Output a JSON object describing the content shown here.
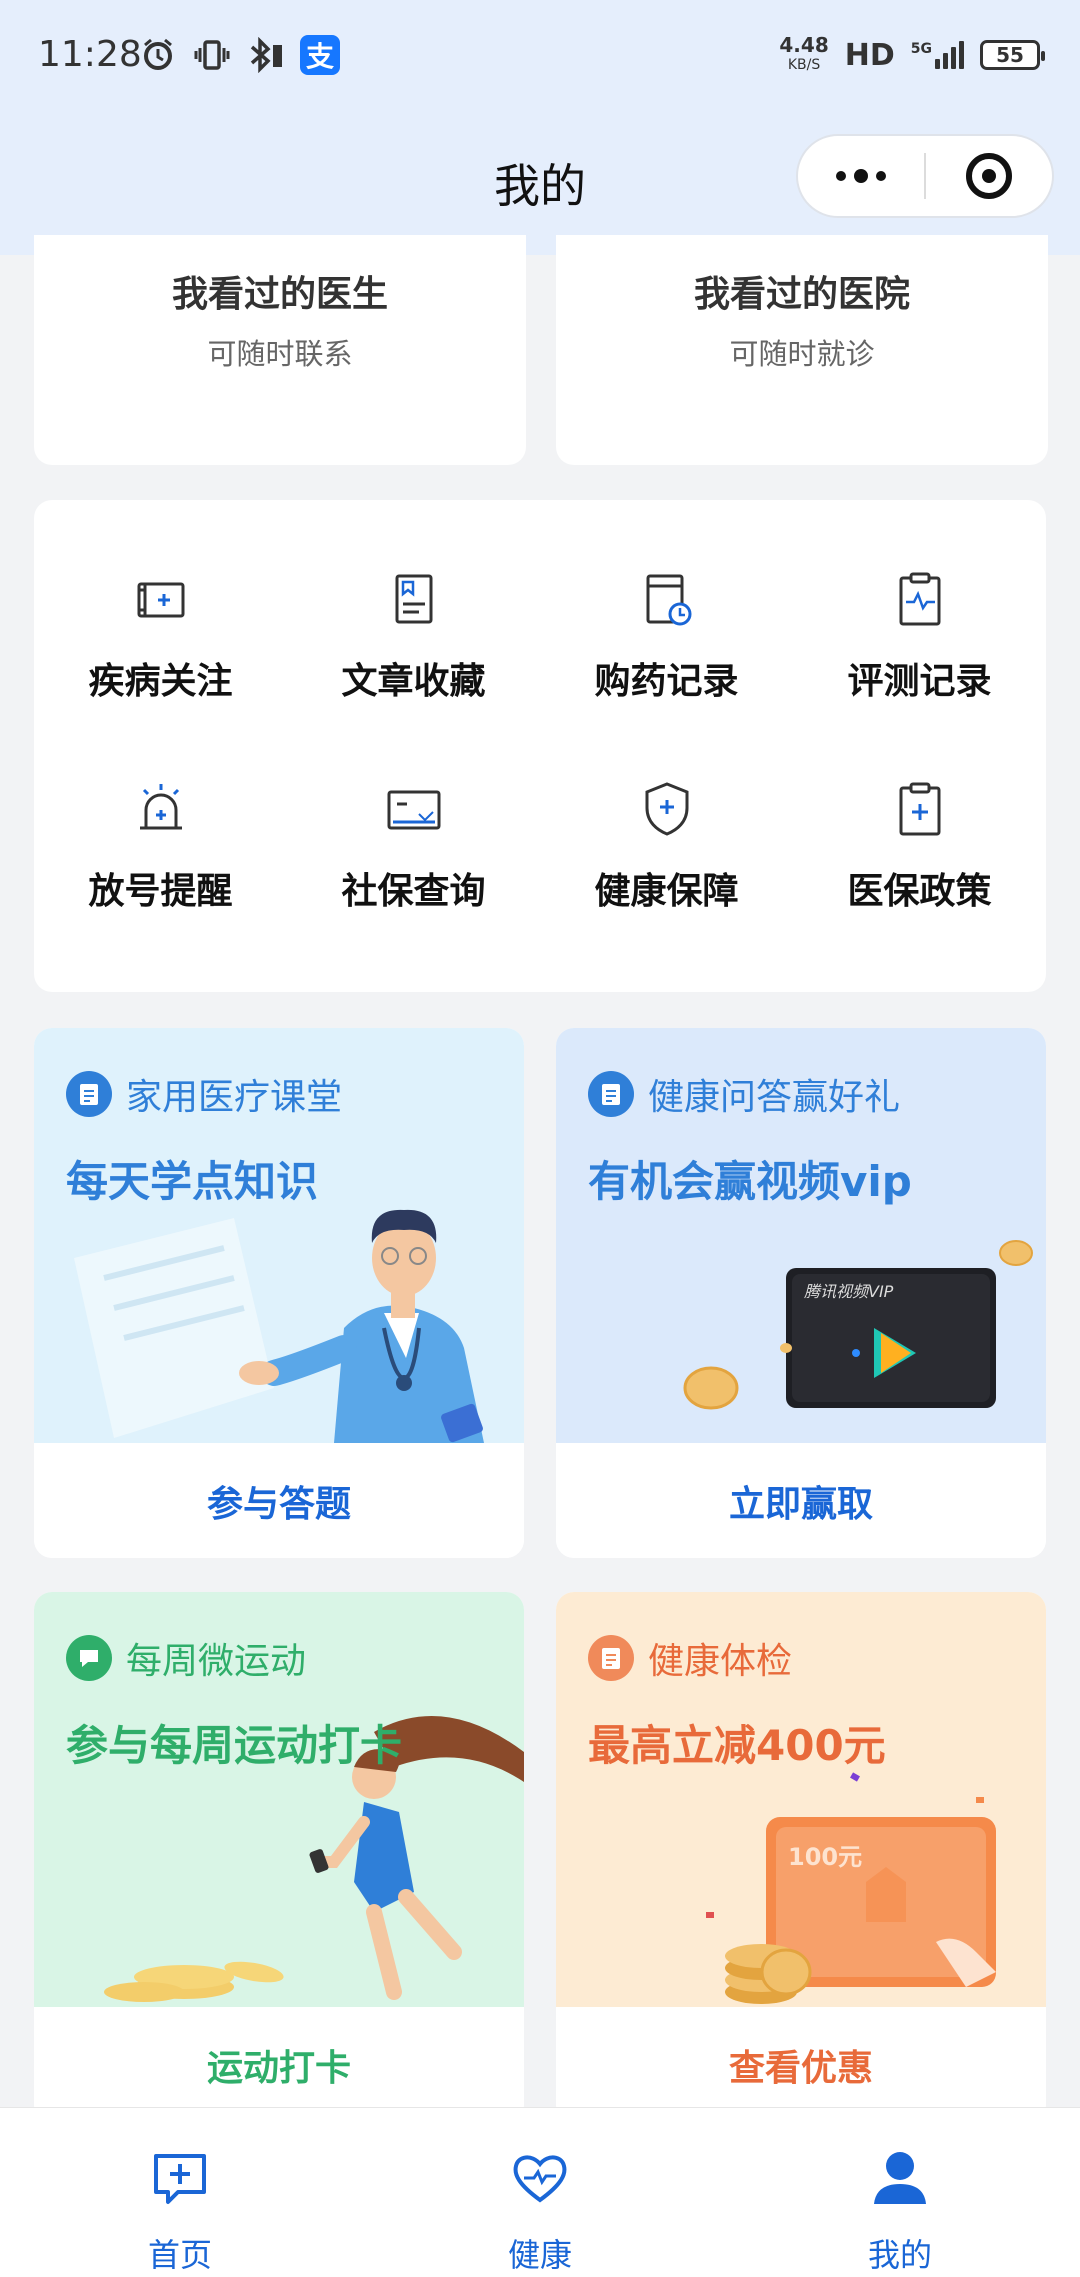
{
  "status_bar": {
    "time": "11:28",
    "net_speed": "4.48",
    "net_unit": "KB/S",
    "hd": "HD",
    "network": "5G",
    "battery": "55",
    "icons": [
      "alarm-icon",
      "vibrate-icon",
      "bluetooth-icon",
      "alipay-icon"
    ]
  },
  "nav": {
    "title": "我的",
    "icons": [
      "more-dots-icon",
      "close-target-icon"
    ]
  },
  "history": [
    {
      "title": "我看过的医生",
      "subtitle": "可随时联系"
    },
    {
      "title": "我看过的医院",
      "subtitle": "可随时就诊"
    }
  ],
  "services": [
    {
      "label": "疾病关注",
      "icon": "disease-follow-icon"
    },
    {
      "label": "文章收藏",
      "icon": "article-bookmark-icon"
    },
    {
      "label": "购药记录",
      "icon": "medicine-record-icon"
    },
    {
      "label": "评测记录",
      "icon": "assessment-record-icon"
    },
    {
      "label": "放号提醒",
      "icon": "alarm-bell-icon"
    },
    {
      "label": "社保查询",
      "icon": "social-insurance-icon"
    },
    {
      "label": "健康保障",
      "icon": "health-shield-icon"
    },
    {
      "label": "医保政策",
      "icon": "medical-policy-icon"
    }
  ],
  "promos": [
    {
      "category": "家用医疗课堂",
      "headline": "每天学点知识",
      "action": "参与答题",
      "accent": "#2f7fd8",
      "bg": "#dff2fc"
    },
    {
      "category": "健康问答赢好礼",
      "headline": "有机会赢视频vip",
      "action": "立即赢取",
      "accent": "#2f7fd8",
      "bg": "#dbe9fb",
      "vip_card_text": "腾讯视频VIP"
    },
    {
      "category": "每周微运动",
      "headline": "参与每周运动打卡",
      "action": "运动打卡",
      "accent": "#2fae6a",
      "bg": "#d9f5e6"
    },
    {
      "category": "健康体检",
      "headline": "最高立减400元",
      "action": "查看优惠",
      "accent": "#e86a3a",
      "bg": "#fdebd3",
      "coupon_text": "100元"
    }
  ],
  "tabs": [
    {
      "label": "首页",
      "icon": "home-chat-plus-icon"
    },
    {
      "label": "健康",
      "icon": "health-heart-icon"
    },
    {
      "label": "我的",
      "icon": "user-profile-icon",
      "active": true
    }
  ],
  "colors": {
    "header_bg": "#e5eefc",
    "primary_blue": "#1a66d6",
    "page_bg": "#f2f3f5"
  }
}
